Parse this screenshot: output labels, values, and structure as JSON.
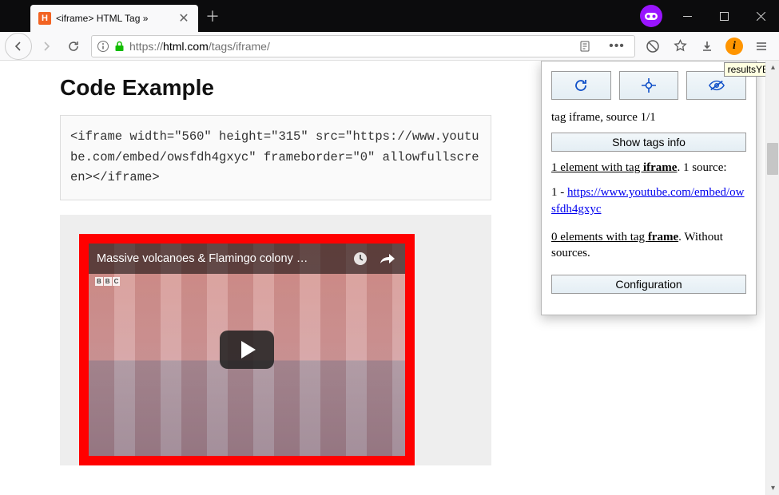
{
  "tab": {
    "favicon_letter": "H",
    "title": "<iframe> HTML Tag »"
  },
  "url": {
    "protocol": "https://",
    "domain": "html.com",
    "path": "/tags/iframe/"
  },
  "page": {
    "heading": "Code Example",
    "code": "<iframe width=\"560\" height=\"315\" src=\"https://www.youtube.com/embed/owsfdh4gxyc\" frameborder=\"0\" allowfullscreen></iframe>",
    "video_title": "Massive volcanoes & Flamingo colony …",
    "bbc": [
      "B",
      "B",
      "C"
    ]
  },
  "panel": {
    "caption": "tag iframe, source 1/1",
    "show_tags_label": "Show tags info",
    "summary_prefix": "1 element with tag ",
    "summary_tag": "iframe",
    "summary_suffix": ". 1 source:",
    "src_index": "1 - ",
    "src_url": "https://www.youtube.com/embed/owsfdh4gxyc",
    "frame_prefix": "0 elements with tag ",
    "frame_tag": "frame",
    "frame_suffix": ". Without sources.",
    "config_label": "Configuration"
  },
  "tooltip": "resultsYES"
}
